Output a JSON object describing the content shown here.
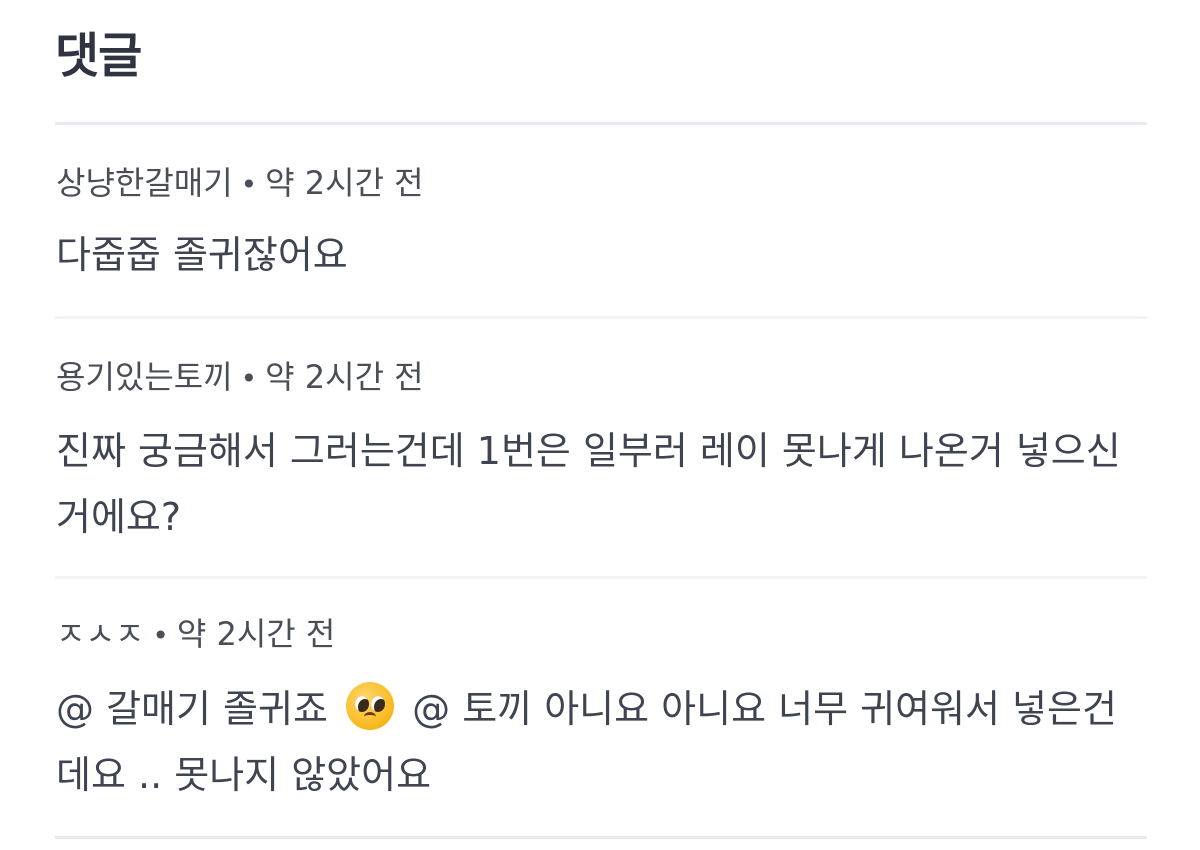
{
  "header": {
    "title": "댓글"
  },
  "comments": [
    {
      "author": "상냥한갈매기",
      "separator": "•",
      "time": "약 2시간 전",
      "body": "다줍줍 졸귀잖어요"
    },
    {
      "author": "용기있는토끼",
      "separator": "•",
      "time": "약 2시간 전",
      "body": "진짜 궁금해서 그러는건데 1번은 일부러 레이 못나게 나온거 넣으신거에요?"
    },
    {
      "author": "ㅈㅅㅈ",
      "separator": "•",
      "time": "약 2시간 전",
      "body_part1": "@ 갈매기 졸귀죠",
      "emoji": "pleading-face-emoji",
      "body_part2": "@ 토끼 아니요 아니요 너무 귀여워서 넣은건데요 .. 못나지 않았어요"
    }
  ],
  "colors": {
    "title": "#2f3540",
    "meta": "#4a4f57",
    "body": "#3f4550",
    "divider": "#e6ebf2"
  }
}
